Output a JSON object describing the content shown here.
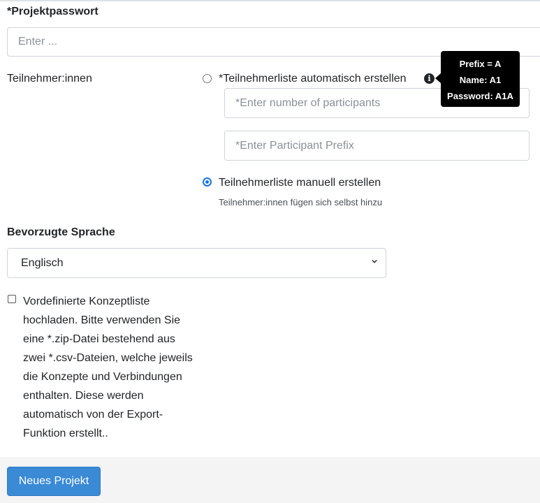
{
  "form": {
    "password_label": "*Projektpasswort",
    "password_placeholder": "Enter ...",
    "participants_label": "Teilnehmer:innen",
    "auto_option_label": "*Teilnehmerliste automatisch erstellen",
    "auto_option_selected": false,
    "number_placeholder": "*Enter number of participants",
    "prefix_placeholder": "*Enter Participant Prefix",
    "manual_option_label": "Teilnehmerliste manuell erstellen",
    "manual_option_selected": true,
    "manual_hint": "Teilnehmer:innen fügen sich selbst hinzu",
    "language_label": "Bevorzugte Sprache",
    "language_selected": "Englisch",
    "upload_checkbox_checked": false,
    "upload_checkbox_label": "Vordefinierte Konzeptliste hochladen. Bitte verwenden Sie eine *.zip-Datei bestehend aus zwei *.csv-Dateien, welche jeweils die Konzepte und Verbindungen enthalten. Diese werden automatisch von der Export-Funktion erstellt.."
  },
  "tooltip": {
    "line1": "Prefix = A",
    "line2": "Name: A1",
    "line3": "Password: A1A"
  },
  "footer": {
    "new_project_label": "Neues Projekt"
  },
  "colors": {
    "primary_button": "#3a8ad6",
    "radio_checked": "#1a73e8",
    "tooltip_bg": "#000000"
  },
  "icons": {
    "info": "info-icon",
    "select_chevron": "chevron-down-icon"
  }
}
